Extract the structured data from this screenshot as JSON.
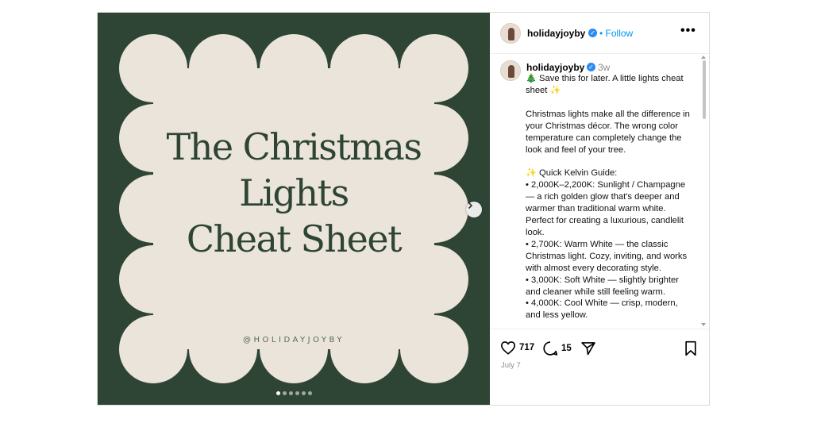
{
  "account": {
    "username": "holidayjoyby",
    "verified_mark": "✓",
    "follow_label": "Follow",
    "separator": "•"
  },
  "more_label": "•••",
  "image": {
    "title_lines": [
      "The Christmas",
      "Lights",
      "Cheat Sheet"
    ],
    "handle": "@HOLIDAYJOYBY",
    "colors": {
      "background": "#2e4535",
      "scallop": "#ebe4da",
      "text": "#2e4535"
    },
    "carousel": {
      "count": 6,
      "active_index": 0
    }
  },
  "post": {
    "time_ago": "3w",
    "caption": [
      "🎄 Save this for later. A little lights cheat sheet ✨",
      "",
      "Christmas lights make all the difference in your Christmas décor. The wrong color temperature can completely change the look and feel of your tree.",
      "",
      "✨ Quick Kelvin Guide:",
      "• 2,000K–2,200K: Sunlight / Champagne — a rich golden glow that's deeper and warmer than traditional warm white. Perfect for creating a luxurious, candlelit look.",
      "• 2,700K: Warm White — the classic Christmas light. Cozy, inviting, and works with almost every decorating style.",
      "• 3,000K: Soft White — slightly brighter and cleaner while still feeling warm.",
      "• 4,000K: Cool White — crisp, modern, and less yellow."
    ],
    "likes": "717",
    "comments": "15",
    "date": "July 7"
  },
  "icons": {
    "verified": "verified-badge-icon",
    "more": "more-options-icon",
    "next": "chevron-right-icon",
    "like": "heart-icon",
    "comment": "comment-bubble-icon",
    "share": "paper-plane-icon",
    "save": "bookmark-icon"
  }
}
